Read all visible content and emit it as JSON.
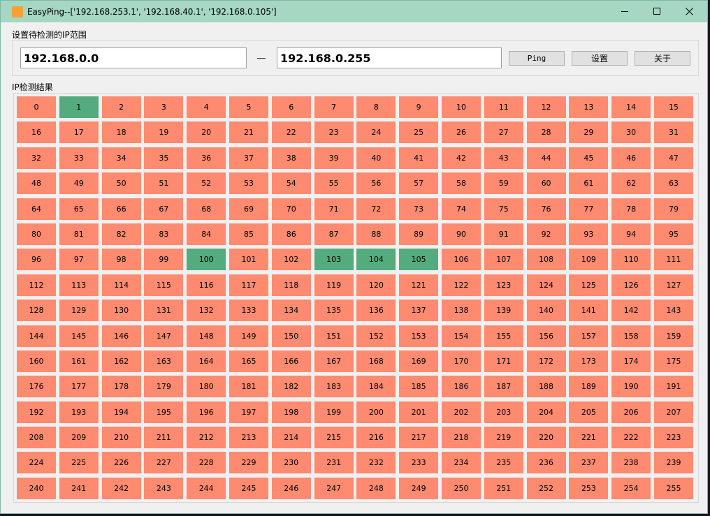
{
  "window": {
    "title": "EasyPing--['192.168.253.1', '192.168.40.1', '192.168.0.105']"
  },
  "range": {
    "label": "设置待检测的IP范围",
    "start_ip": "192.168.0.0",
    "end_ip": "192.168.0.255",
    "ping_label": "Ping",
    "settings_label": "设置",
    "about_label": "关于"
  },
  "results": {
    "label": "IP检测结果",
    "host_count": 256,
    "reachable_hosts": [
      1,
      100,
      103,
      104,
      105
    ],
    "colors": {
      "reachable": "#54ab7d",
      "unreachable": "#fe8a70"
    }
  },
  "icons": {
    "app": "app-icon",
    "minimize": "minimize-icon",
    "maximize": "maximize-icon",
    "close": "close-icon"
  }
}
